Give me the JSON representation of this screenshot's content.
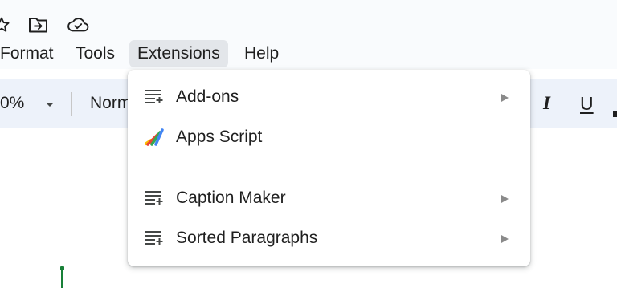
{
  "icon_row": {
    "icons": [
      "star-icon",
      "move-to-folder-icon",
      "cloud-saved-icon"
    ]
  },
  "menubar": {
    "items": [
      {
        "label": "Format"
      },
      {
        "label": "Tools"
      },
      {
        "label": "Extensions"
      },
      {
        "label": "Help"
      }
    ],
    "active": "Extensions"
  },
  "toolbar": {
    "zoom": "0%",
    "style": "Norm",
    "italic": "I",
    "underline": "U"
  },
  "extensions_menu": {
    "items": [
      {
        "label": "Add-ons",
        "icon": "add-ons-icon",
        "submenu": true
      },
      {
        "label": "Apps Script",
        "icon": "apps-script-icon",
        "submenu": false
      },
      {
        "label": "Caption Maker",
        "icon": "add-on-app-icon",
        "submenu": true
      },
      {
        "label": "Sorted Paragraphs",
        "icon": "add-on-app-icon",
        "submenu": true
      }
    ]
  },
  "colors": {
    "menu_active_bg": "#e3e6ea",
    "toolbar_bg": "#edf2fa",
    "cursor": "#188038"
  }
}
